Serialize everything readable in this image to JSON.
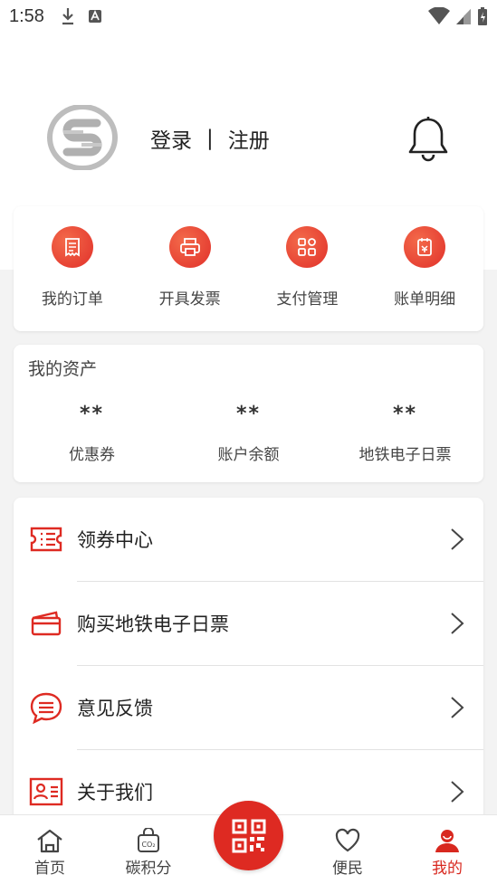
{
  "status_bar": {
    "time": "1:58"
  },
  "header": {
    "login_label": "登录",
    "separator": "|",
    "register_label": "注册"
  },
  "quick_actions": [
    {
      "label": "我的订单",
      "icon": "receipt-icon"
    },
    {
      "label": "开具发票",
      "icon": "printer-icon"
    },
    {
      "label": "支付管理",
      "icon": "grid-icon"
    },
    {
      "label": "账单明细",
      "icon": "bill-icon"
    }
  ],
  "assets": {
    "title": "我的资产",
    "items": [
      {
        "value": "**",
        "label": "优惠券"
      },
      {
        "value": "**",
        "label": "账户余额"
      },
      {
        "value": "**",
        "label": "地铁电子日票"
      }
    ]
  },
  "menu": [
    {
      "label": "领券中心",
      "icon": "coupon-icon"
    },
    {
      "label": "购买地铁电子日票",
      "icon": "wallet-icon"
    },
    {
      "label": "意见反馈",
      "icon": "chat-icon"
    },
    {
      "label": "关于我们",
      "icon": "contact-card-icon"
    }
  ],
  "tabbar": {
    "tabs": [
      {
        "label": "首页",
        "icon": "home-icon"
      },
      {
        "label": "碳积分",
        "icon": "co2-bag-icon"
      },
      {
        "label": "便民",
        "icon": "heart-icon"
      },
      {
        "label": "我的",
        "icon": "user-icon"
      }
    ],
    "scan_icon": "qr-code-icon"
  },
  "colors": {
    "accent": "#de2a22",
    "active_tab": "#d8281f"
  }
}
